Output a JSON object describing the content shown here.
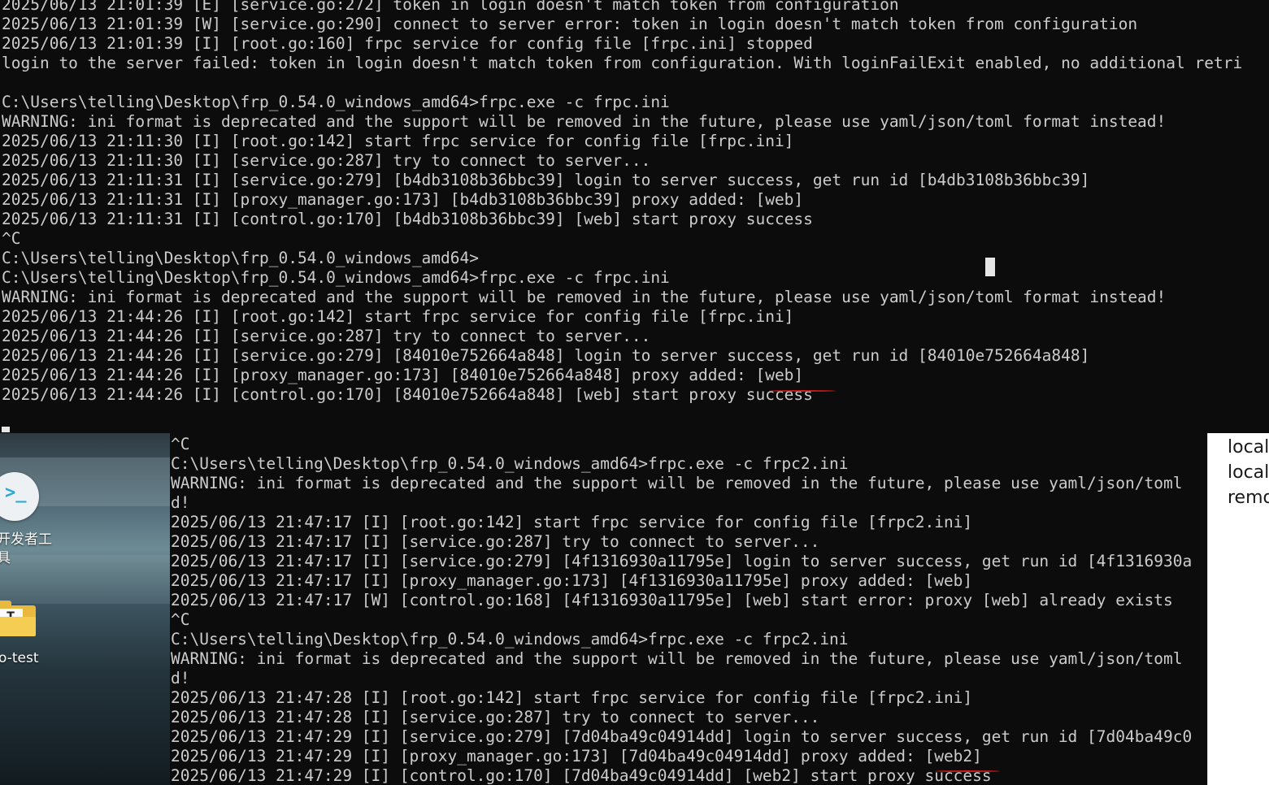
{
  "terminal_top": {
    "lines": [
      "2025/06/13 21:01:39 [E] [service.go:272] token in login doesn't match token from configuration",
      "2025/06/13 21:01:39 [W] [service.go:290] connect to server error: token in login doesn't match token from configuration",
      "2025/06/13 21:01:39 [I] [root.go:160] frpc service for config file [frpc.ini] stopped",
      "login to the server failed: token in login doesn't match token from configuration. With loginFailExit enabled, no additional retri",
      "",
      "C:\\Users\\telling\\Desktop\\frp_0.54.0_windows_amd64>frpc.exe -c frpc.ini",
      "WARNING: ini format is deprecated and the support will be removed in the future, please use yaml/json/toml format instead!",
      "2025/06/13 21:11:30 [I] [root.go:142] start frpc service for config file [frpc.ini]",
      "2025/06/13 21:11:30 [I] [service.go:287] try to connect to server...",
      "2025/06/13 21:11:31 [I] [service.go:279] [b4db3108b36bbc39] login to server success, get run id [b4db3108b36bbc39]",
      "2025/06/13 21:11:31 [I] [proxy_manager.go:173] [b4db3108b36bbc39] proxy added: [web]",
      "2025/06/13 21:11:31 [I] [control.go:170] [b4db3108b36bbc39] [web] start proxy success",
      "^C",
      "C:\\Users\\telling\\Desktop\\frp_0.54.0_windows_amd64>",
      "C:\\Users\\telling\\Desktop\\frp_0.54.0_windows_amd64>frpc.exe -c frpc.ini",
      "WARNING: ini format is deprecated and the support will be removed in the future, please use yaml/json/toml format instead!",
      "2025/06/13 21:44:26 [I] [root.go:142] start frpc service for config file [frpc.ini]",
      "2025/06/13 21:44:26 [I] [service.go:287] try to connect to server...",
      "2025/06/13 21:44:26 [I] [service.go:279] [84010e752664a848] login to server success, get run id [84010e752664a848]",
      "2025/06/13 21:44:26 [I] [proxy_manager.go:173] [84010e752664a848] proxy added: [web]",
      "2025/06/13 21:44:26 [I] [control.go:170] [84010e752664a848] [web] start proxy success"
    ]
  },
  "terminal_bottom": {
    "lines": [
      "^C",
      "C:\\Users\\telling\\Desktop\\frp_0.54.0_windows_amd64>frpc.exe -c frpc2.ini",
      "WARNING: ini format is deprecated and the support will be removed in the future, please use yaml/json/toml",
      "d!",
      "2025/06/13 21:47:17 [I] [root.go:142] start frpc service for config file [frpc2.ini]",
      "2025/06/13 21:47:17 [I] [service.go:287] try to connect to server...",
      "2025/06/13 21:47:17 [I] [service.go:279] [4f1316930a11795e] login to server success, get run id [4f1316930a",
      "2025/06/13 21:47:17 [I] [proxy_manager.go:173] [4f1316930a11795e] proxy added: [web]",
      "2025/06/13 21:47:17 [W] [control.go:168] [4f1316930a11795e] [web] start error: proxy [web] already exists",
      "^C",
      "C:\\Users\\telling\\Desktop\\frp_0.54.0_windows_amd64>frpc.exe -c frpc2.ini",
      "WARNING: ini format is deprecated and the support will be removed in the future, please use yaml/json/toml",
      "d!",
      "2025/06/13 21:47:28 [I] [root.go:142] start frpc service for config file [frpc2.ini]",
      "2025/06/13 21:47:28 [I] [service.go:287] try to connect to server...",
      "2025/06/13 21:47:29 [I] [service.go:279] [7d04ba49c04914dd] login to server success, get run id [7d04ba49c0",
      "2025/06/13 21:47:29 [I] [proxy_manager.go:173] [7d04ba49c04914dd] proxy added: [web2]",
      "2025/06/13 21:47:29 [I] [control.go:170] [7d04ba49c04914dd] [web2] start proxy success"
    ]
  },
  "desktop": {
    "icons": [
      {
        "label": "开发者工\n具",
        "icon": "powershell-icon"
      },
      {
        "label": "o-test",
        "icon": "folder-icon",
        "glyph": "T"
      }
    ]
  },
  "right_panel": {
    "lines": [
      "local",
      "local",
      "remo"
    ]
  },
  "colors": {
    "terminal_bg": "#0c0c0c",
    "terminal_fg": "#cccccc",
    "annotation_red": "#d11a1a"
  }
}
